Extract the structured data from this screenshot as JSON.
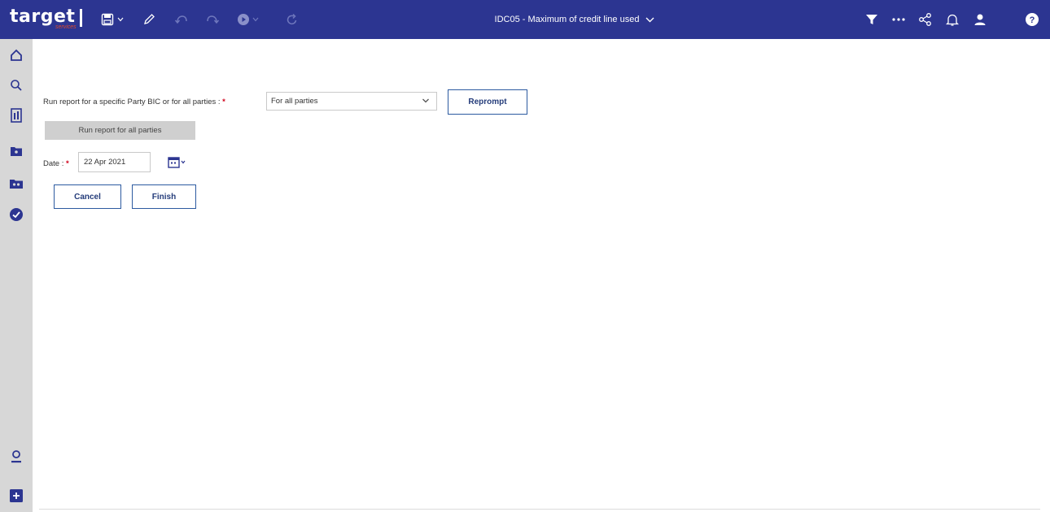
{
  "app": {
    "logo_text": "target",
    "logo_sub": "services",
    "report_title": "IDC05 - Maximum of credit line used"
  },
  "colors": {
    "header_bg": "#2c3591",
    "sidebar_bg": "#d7d7d7",
    "required_marker": "#d0021b",
    "button_border": "#2c5aa0",
    "disabled_button_bg": "#cfcfcf"
  },
  "toolbar": {
    "icons": [
      "save-icon",
      "save-dropdown-icon",
      "edit-pencil-icon",
      "undo-icon",
      "redo-icon",
      "run-icon",
      "run-dropdown-icon",
      "refresh-icon"
    ],
    "right_icons": [
      "filter-icon",
      "more-icon",
      "share-icon",
      "notification-bell-icon",
      "user-icon",
      "help-icon"
    ]
  },
  "sidebar": {
    "items": [
      "home-icon",
      "search-icon",
      "content-icon",
      "team-folder-icon",
      "my-folder-icon",
      "check-icon"
    ],
    "bottom_items": [
      "account-icon",
      "new-icon"
    ]
  },
  "prompt": {
    "party_label": "Run report for a specific Party BIC or for all parties : ",
    "required_mark": "*",
    "party_selected": "For all parties",
    "reprompt_label": "Reprompt",
    "run_all_label": "Run report for all parties",
    "date_label": "Date : ",
    "date_value": "22 Apr 2021",
    "cancel_label": "Cancel",
    "finish_label": "Finish"
  }
}
